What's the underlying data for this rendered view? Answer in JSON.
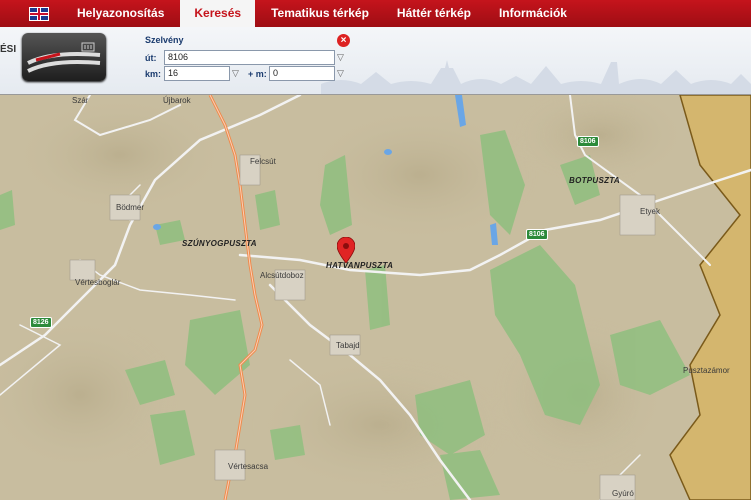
{
  "nav": {
    "language_flag": "uk-flag-icon",
    "tabs": [
      {
        "label": "Helyazonosítás",
        "active": false
      },
      {
        "label": "Keresés",
        "active": true
      },
      {
        "label": "Tematikus térkép",
        "active": false
      },
      {
        "label": "Háttér térkép",
        "active": false
      },
      {
        "label": "Információk",
        "active": false
      }
    ]
  },
  "panel": {
    "cut_label": "ÉSI",
    "form_title": "Szelvény",
    "ut_label": "út:",
    "ut_value": "8106",
    "km_label": "km:",
    "km_value": "16",
    "plus_m_label": "+ m:",
    "m_value": "0"
  },
  "map": {
    "marker": "map-pin-icon",
    "places": [
      {
        "name": "Szár",
        "kind": "town"
      },
      {
        "name": "Újbarok",
        "kind": "town"
      },
      {
        "name": "Felcsút",
        "kind": "town"
      },
      {
        "name": "Bödmer",
        "kind": "town"
      },
      {
        "name": "SZÚNYOGPUSZTA",
        "kind": "locality"
      },
      {
        "name": "Vértesboglár",
        "kind": "town"
      },
      {
        "name": "Alcsútdoboz",
        "kind": "town"
      },
      {
        "name": "HATVANPUSZTA",
        "kind": "locality"
      },
      {
        "name": "Tabajd",
        "kind": "town"
      },
      {
        "name": "BOTPUSZTA",
        "kind": "locality"
      },
      {
        "name": "Etyek",
        "kind": "town"
      },
      {
        "name": "Pusztazámor",
        "kind": "town"
      },
      {
        "name": "Vértesacsa",
        "kind": "town"
      },
      {
        "name": "Gyúró",
        "kind": "town"
      }
    ],
    "road_numbers": [
      "8106",
      "8106",
      "8126"
    ],
    "colors": {
      "terrain": "#c8bd9f",
      "forest": "#8fbf7f",
      "road": "#f2f2f2",
      "main_road": "#f08a4b",
      "county_area": "#d9b45a",
      "water": "#6aa6e6"
    }
  }
}
